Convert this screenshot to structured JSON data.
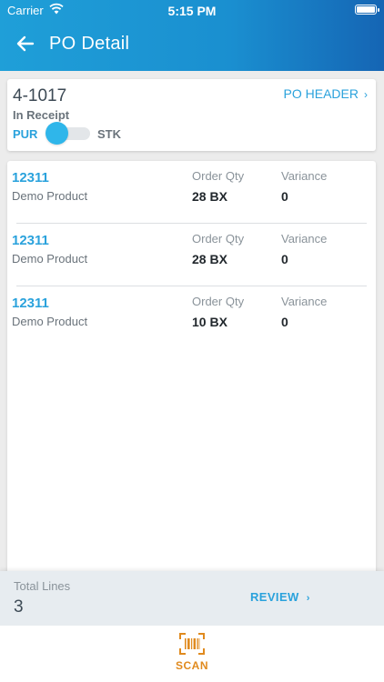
{
  "status_bar": {
    "carrier": "Carrier",
    "time": "5:15 PM"
  },
  "header": {
    "title": "PO Detail"
  },
  "po": {
    "number": "4-1017",
    "status": "In Receipt",
    "header_link": "PO HEADER",
    "toggle": {
      "left_label": "PUR",
      "right_label": "STK",
      "selected": "PUR"
    }
  },
  "lines": [
    {
      "code": "12311",
      "name": "Demo Product",
      "qty_label": "Order Qty",
      "qty": "28 BX",
      "var_label": "Variance",
      "variance": "0"
    },
    {
      "code": "12311",
      "name": "Demo Product",
      "qty_label": "Order Qty",
      "qty": "28 BX",
      "var_label": "Variance",
      "variance": "0"
    },
    {
      "code": "12311",
      "name": "Demo Product",
      "qty_label": "Order Qty",
      "qty": "10 BX",
      "var_label": "Variance",
      "variance": "0"
    }
  ],
  "footer": {
    "total_label": "Total Lines",
    "total_value": "3",
    "review_label": "REVIEW"
  },
  "tabbar": {
    "scan_label": "SCAN"
  },
  "colors": {
    "accent": "#2aa2dc",
    "header_start": "#1f9fd8",
    "header_end": "#1565b4",
    "scan": "#e08a1e"
  },
  "icons": {
    "back": "arrow-left-icon",
    "link": "chevron-right-icon",
    "scan": "barcode-scan-icon",
    "wifi": "wifi-icon",
    "battery": "battery-icon"
  }
}
